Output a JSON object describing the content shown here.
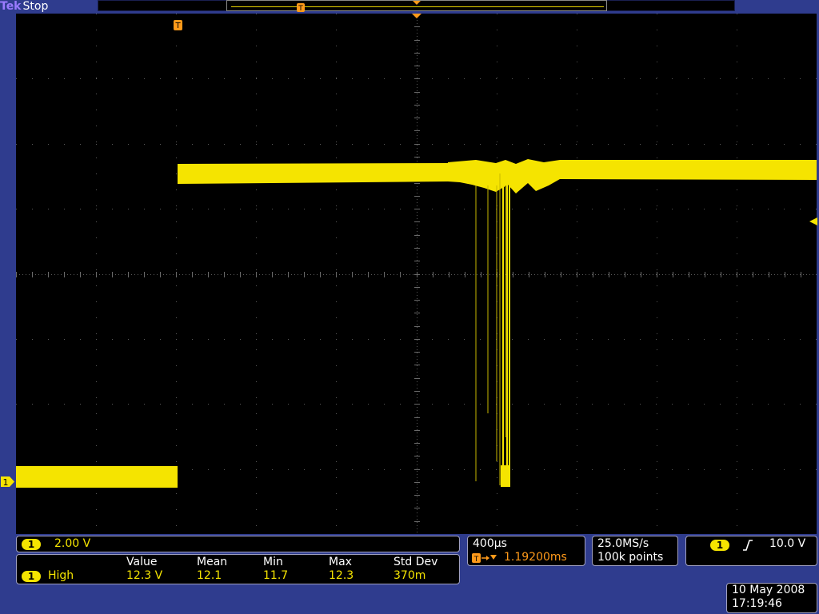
{
  "header": {
    "brand": "Tek",
    "status": "Stop"
  },
  "markers": {
    "trigger_label": "T",
    "channel_label": "1"
  },
  "channel": {
    "badge": "1",
    "scale": "2.00 V",
    "color": "#f5e400"
  },
  "measurements": {
    "headers": [
      "Value",
      "Mean",
      "Min",
      "Max",
      "Std Dev"
    ],
    "badge": "1",
    "name": "High",
    "values": [
      "12.3 V",
      "12.1",
      "11.7",
      "12.3",
      "370m"
    ]
  },
  "timebase": {
    "scale": "400µs",
    "trigger_position": "1.19200ms",
    "trigger_icon": "trigger-position-icon"
  },
  "acquisition": {
    "sample_rate": "25.0MS/s",
    "record_length": "100k points"
  },
  "trigger": {
    "badge": "1",
    "slope_icon": "rising-edge-icon",
    "level": "10.0 V"
  },
  "datetime": {
    "date": "10 May 2008",
    "time": "17:19:46"
  },
  "colors": {
    "background": "#2f3c8e",
    "trace": "#f5e400",
    "marker": "#ff9a1a"
  }
}
